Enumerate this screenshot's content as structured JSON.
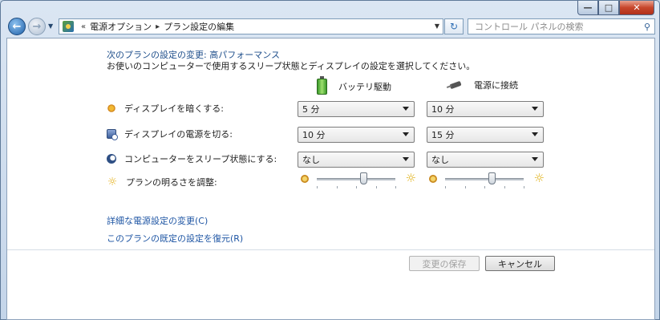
{
  "window": {
    "caption_buttons": {
      "min": "—",
      "max": "□",
      "close": "✕"
    }
  },
  "navbar": {
    "back_glyph": "←",
    "forward_glyph": "→",
    "chevrons": "«",
    "breadcrumbs": [
      "電源オプション",
      "プラン設定の編集"
    ],
    "refresh_glyph": "↻",
    "search_placeholder": "コントロール パネルの検索"
  },
  "main": {
    "heading": "次のプランの設定の変更: 高パフォーマンス",
    "subtext": "お使いのコンピューターで使用するスリープ状態とディスプレイの設定を選択してください。",
    "columns": {
      "battery": "バッテリ駆動",
      "plugged": "電源に接続"
    },
    "settings": [
      {
        "label": "ディスプレイを暗くする:",
        "icon": "dim-display-icon",
        "battery": "5 分",
        "plugged": "10 分"
      },
      {
        "label": "ディスプレイの電源を切る:",
        "icon": "display-off-icon",
        "battery": "10 分",
        "plugged": "15 分"
      },
      {
        "label": "コンピューターをスリープ状態にする:",
        "icon": "sleep-moon-icon",
        "battery": "なし",
        "plugged": "なし"
      }
    ],
    "brightness": {
      "label": "プランの明るさを調整:",
      "battery_level": 0.6,
      "plugged_level": 0.6
    },
    "links": {
      "advanced": "詳細な電源設定の変更(C)",
      "restore": "このプランの既定の設定を復元(R)"
    }
  },
  "footer": {
    "save_label": "変更の保存",
    "cancel_label": "キャンセル"
  }
}
